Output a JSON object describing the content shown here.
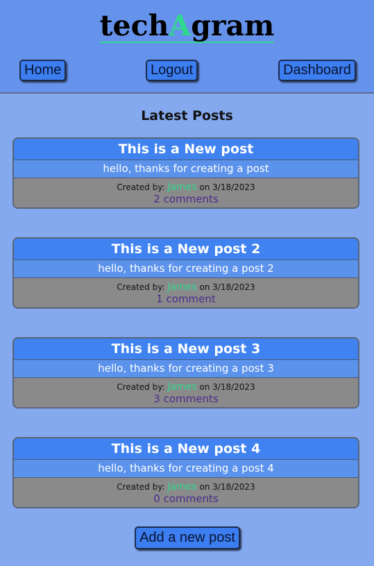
{
  "header": {
    "logo_prefix": "tech",
    "logo_accent": "A",
    "logo_suffix": "gram",
    "accent_color": "#2fd88e",
    "nav": {
      "home_label": "Home",
      "logout_label": "Logout",
      "dashboard_label": "Dashboard"
    }
  },
  "main": {
    "section_title": "Latest Posts",
    "posts": [
      {
        "title": "This is a New post",
        "body": "hello, thanks for creating a post",
        "created_by_label": "Created by: ",
        "author": "James",
        "on_label": " on ",
        "date": "3/18/2023",
        "comments": "2 comments"
      },
      {
        "title": "This is a New post 2",
        "body": "hello, thanks for creating a post 2",
        "created_by_label": "Created by: ",
        "author": "James",
        "on_label": " on ",
        "date": "3/18/2023",
        "comments": "1 comment"
      },
      {
        "title": "This is a New post 3",
        "body": "hello, thanks for creating a post 3",
        "created_by_label": "Created by: ",
        "author": "James",
        "on_label": " on ",
        "date": "3/18/2023",
        "comments": "3 comments"
      },
      {
        "title": "This is a New post 4",
        "body": "hello, thanks for creating a post 4",
        "created_by_label": "Created by: ",
        "author": "James",
        "on_label": " on ",
        "date": "3/18/2023",
        "comments": "0 comments"
      }
    ],
    "add_post_label": "Add a new post"
  }
}
